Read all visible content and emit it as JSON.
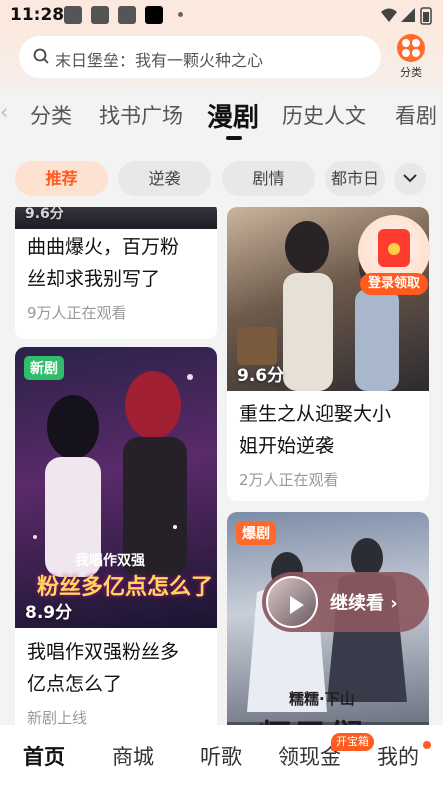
{
  "status_bar": {
    "time": "11:28"
  },
  "search": {
    "text": "末日堡垒：我有一颗火种之心"
  },
  "category_button": {
    "label": "分类"
  },
  "tabs": [
    {
      "label": "分类"
    },
    {
      "label": "找书广场"
    },
    {
      "label": "漫剧",
      "active": true
    },
    {
      "label": "历史人文"
    },
    {
      "label": "看剧"
    }
  ],
  "chips": [
    {
      "label": "推荐",
      "active": true
    },
    {
      "label": "逆袭"
    },
    {
      "label": "剧情"
    },
    {
      "label": "都市日"
    }
  ],
  "cards": {
    "left_top": {
      "title_line1": "曲曲爆火，百万粉",
      "title_line2": "丝却求我别写了",
      "viewers": "9万人正在观看",
      "score_partial": "9.6分"
    },
    "right_top": {
      "score": "9.6分",
      "title_line1": "重生之从迎娶大小",
      "title_line2": "姐开始逆袭",
      "viewers": "2万人正在观看"
    },
    "left_bottom": {
      "badge": "新剧",
      "score": "8.9分",
      "cover_text_line1": "我唱作双强",
      "cover_text_line2": "粉丝多亿点怎么了",
      "title_line1": "我唱作双强粉丝多",
      "title_line2": "亿点怎么了",
      "sub": "新剧上线"
    },
    "right_bottom": {
      "badge": "爆剧",
      "cover_text_small": "糯糯·下山",
      "cover_text_big": "师兄们"
    }
  },
  "reward": {
    "label": "登录领取"
  },
  "continue_watching": {
    "label": "继续看 ›"
  },
  "bottom_nav": {
    "items": [
      {
        "label": "首页",
        "active": true
      },
      {
        "label": "商城"
      },
      {
        "label": "听歌"
      },
      {
        "label": "领现金"
      },
      {
        "label": "我的"
      }
    ],
    "cash_badge": "开宝箱"
  },
  "colors": {
    "accent": "#ff5a1f",
    "new_badge": "#2fbf6a"
  }
}
